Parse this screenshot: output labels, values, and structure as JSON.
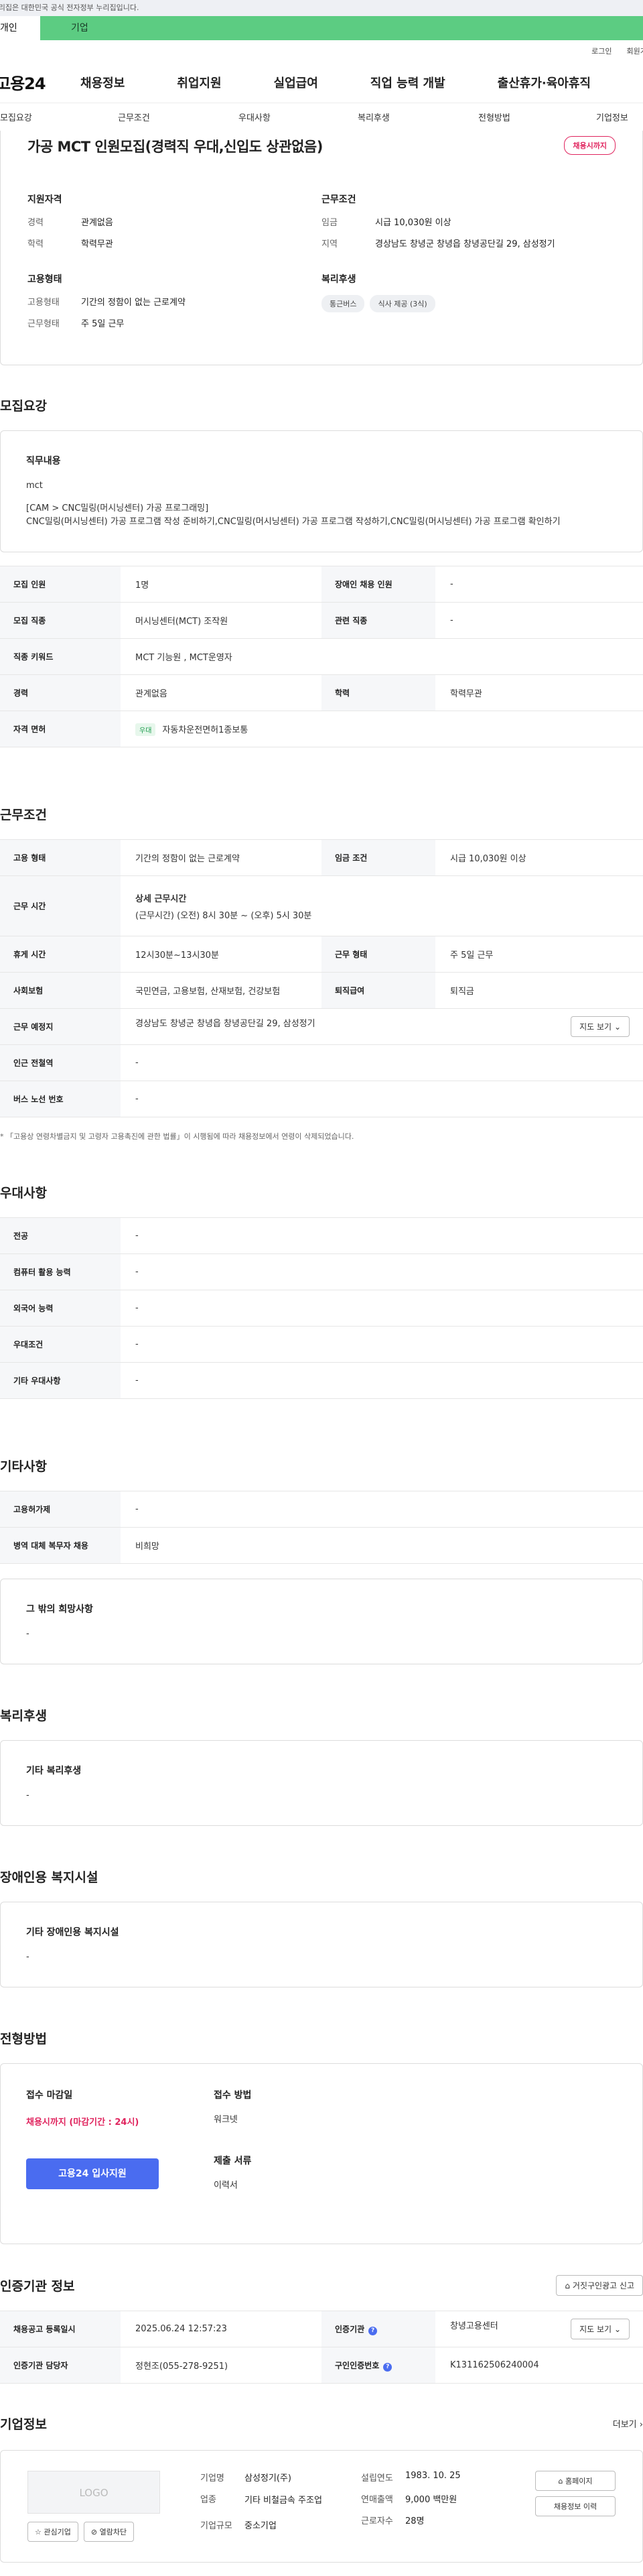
{
  "gov_notice": "이 누리집은 대한민국 공식 전자정부 누리집입니다.",
  "usertype": {
    "personal": "개인",
    "business": "기업"
  },
  "util": {
    "login": "로그인",
    "signup": "회원가입"
  },
  "gnb": {
    "logo": "고용24",
    "menu": [
      "채용정보",
      "취업지원",
      "실업급여",
      "직업 능력 개발",
      "출산휴가·육아휴직"
    ]
  },
  "subnav": [
    "모집요강",
    "근무조건",
    "우대사항",
    "복리후생",
    "전형방법",
    "기업정보"
  ],
  "summary": {
    "title": "가공 MCT 인원모집(경력직 우대,신입도 상관없음)",
    "status_badge": "채용시까지",
    "qual_title": "지원자격",
    "career_label": "경력",
    "career_value": "관계없음",
    "edu_label": "학력",
    "edu_value": "학력무관",
    "emp_title": "고용형태",
    "emp_type_label": "고용형태",
    "emp_type_value": "기간의 정함이 없는 근로계약",
    "work_form_label": "근무형태",
    "work_form_value": "주 5일 근무",
    "cond_title": "근무조건",
    "wage_label": "임금",
    "wage_value": "시급 10,030원 이상",
    "region_label": "지역",
    "region_value": "경상남도 창녕군 창녕읍 창녕공단길 29, 삼성정기",
    "welfare_title": "복리후생",
    "welfare_chips": [
      "통근버스",
      "식사 제공 (3식)"
    ]
  },
  "recruit": {
    "title": "모집요강",
    "duty_title": "직무내용",
    "duty_text_1": "mct",
    "duty_text_2": "[CAM > CNC밀링(머시닝센터) 가공 프로그래밍]",
    "duty_text_3": "CNC밀링(머시닝센터) 가공 프로그램 작성 준비하기,CNC밀링(머시닝센터) 가공 프로그램 작성하기,CNC밀링(머시닝센터) 가공 프로그램 확인하기",
    "rows": {
      "headcount_label": "모집 인원",
      "headcount_value": "1명",
      "disabled_label": "장애인 채용 인원",
      "disabled_value": "-",
      "job_label": "모집 직종",
      "job_value": "머시닝센터(MCT) 조작원",
      "related_label": "관련 직종",
      "related_value": "-",
      "keyword_label": "직종 키워드",
      "keyword_value": "MCT 기능원 , MCT운영자",
      "career_label": "경력",
      "career_value": "관계없음",
      "edu_label": "학력",
      "edu_value": "학력무관",
      "license_label": "자격 면허",
      "license_tag": "우대",
      "license_value": "자동차운전면허1종보통"
    }
  },
  "work": {
    "title": "근무조건",
    "type_label": "고용 형태",
    "type_value": "기간의 정함이 없는 근로계약",
    "wage_label": "임금 조건",
    "wage_value": "시급 10,030원 이상",
    "hours_label": "근무 시간",
    "hours_title": "상세 근무시간",
    "hours_value": "(근무시간) (오전) 8시 30분 ~ (오후) 5시 30분",
    "break_label": "휴게 시간",
    "break_value": "12시30분~13시30분",
    "form_label": "근무 형태",
    "form_value": "주 5일 근무",
    "insurance_label": "사회보험",
    "insurance_value": "국민연금, 고용보험, 산재보험, 건강보험",
    "retire_label": "퇴직급여",
    "retire_value": "퇴직금",
    "place_label": "근무 예정지",
    "place_value": "경상남도 창녕군 창녕읍 창녕공단길 29, 삼성정기",
    "map_button": "지도 보기",
    "subway_label": "인근 전철역",
    "subway_value": "-",
    "bus_label": "버스 노선 번호",
    "bus_value": "-",
    "note": "* 「고용상 연령차별금지 및 고령자 고용촉진에 관한 법률」이 시행됨에 따라 채용정보에서 연령이 삭제되었습니다."
  },
  "pref": {
    "title": "우대사항",
    "major_label": "전공",
    "major_value": "-",
    "computer_label": "컴퓨터 활용 능력",
    "computer_value": "-",
    "lang_label": "외국어 능력",
    "lang_value": "-",
    "cond_label": "우대조건",
    "cond_value": "-",
    "etc_label": "기타 우대사항",
    "etc_value": "-"
  },
  "etc": {
    "title": "기타사항",
    "permit_label": "고용허가제",
    "permit_value": "-",
    "military_label": "병역 대체 복무자 채용",
    "military_value": "비희망",
    "other_title": "그 밖의 희망사항",
    "other_value": "-"
  },
  "welfare": {
    "title": "복리후생",
    "box_title": "기타 복리후생",
    "box_value": "-"
  },
  "disabled": {
    "title": "장애인용 복지시설",
    "box_title": "기타 장애인용 복지시설",
    "box_value": "-"
  },
  "process": {
    "title": "전형방법",
    "deadline_title": "접수 마감일",
    "deadline_value": "채용시까지 (마감기간 : 24시)",
    "apply_button": "고용24 입사지원",
    "method_title": "접수 방법",
    "method_value": "워크넷",
    "docs_title": "제출 서류",
    "docs_value": "이력서"
  },
  "cert": {
    "title": "인증기관 정보",
    "report_button": "거짓구인광고 신고",
    "reg_label": "채용공고 등록일시",
    "reg_value": "2025.06.24 12:57:23",
    "org_label": "인증기관",
    "org_value": "창녕고용센터",
    "map_button": "지도 보기",
    "manager_label": "인증기관 담당자",
    "manager_value": "정현조(055-278-9251)",
    "cert_no_label": "구인인증번호",
    "cert_no_value": "K131162506240004"
  },
  "company": {
    "title": "기업정보",
    "more": "더보기",
    "logo": "LOGO",
    "interest_button": "관심기업",
    "block_button": "열람차단",
    "name_label": "기업명",
    "name_value": "삼성정기(주)",
    "industry_label": "업종",
    "industry_value": "기타 비철금속 주조업",
    "size_label": "기업규모",
    "size_value": "중소기업",
    "founded_label": "설립연도",
    "founded_value": "1983. 10. 25",
    "revenue_label": "연매출액",
    "revenue_value": "9,000 백만원",
    "employees_label": "근로자수",
    "employees_value": "28명",
    "homepage_button": "홈페이지",
    "history_button": "채용정보 이력"
  }
}
